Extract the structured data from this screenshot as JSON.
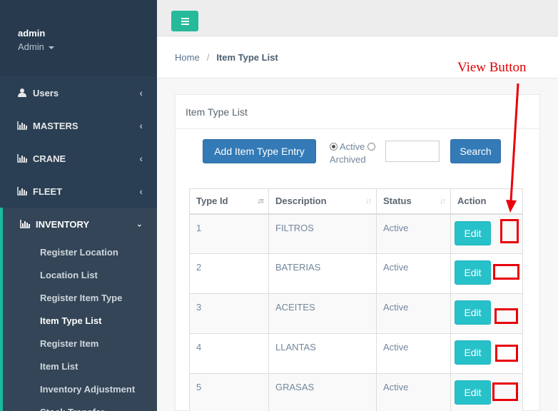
{
  "sidebar": {
    "user": "admin",
    "role": "Admin",
    "menu": [
      {
        "label": "Users",
        "icon": "user-icon"
      },
      {
        "label": "MASTERS",
        "icon": "bar-chart-icon"
      },
      {
        "label": "CRANE",
        "icon": "bar-chart-icon"
      },
      {
        "label": "FLEET",
        "icon": "bar-chart-icon"
      }
    ],
    "active_group": {
      "label": "INVENTORY",
      "icon": "bar-chart-icon",
      "items": [
        "Register Location",
        "Location List",
        "Register Item Type",
        "Item Type List",
        "Register Item",
        "Item List",
        "Inventory Adjustment",
        "Stock Transfer"
      ],
      "current": "Item Type List"
    }
  },
  "breadcrumb": {
    "home": "Home",
    "separator": "/",
    "current": "Item Type List"
  },
  "panel": {
    "title": "Item Type List",
    "add_button": "Add Item Type Entry",
    "radio_active": "Active",
    "radio_archived": "Archived",
    "search_value": "",
    "search_button": "Search"
  },
  "table": {
    "headers": [
      "Type Id",
      "Description",
      "Status",
      "Action"
    ],
    "edit_label": "Edit",
    "rows": [
      {
        "id": "1",
        "description": "FILTROS",
        "status": "Active"
      },
      {
        "id": "2",
        "description": "BATERIAS",
        "status": "Active"
      },
      {
        "id": "3",
        "description": "ACEITES",
        "status": "Active"
      },
      {
        "id": "4",
        "description": "LLANTAS",
        "status": "Active"
      },
      {
        "id": "5",
        "description": "GRASAS",
        "status": "Active"
      }
    ]
  },
  "annotation": {
    "label": "View Button",
    "color": "#e00000"
  },
  "colors": {
    "sidebar": "#2a3f54",
    "accent": "#26b99a",
    "primary": "#337ab7",
    "edit": "#26c1c9"
  }
}
